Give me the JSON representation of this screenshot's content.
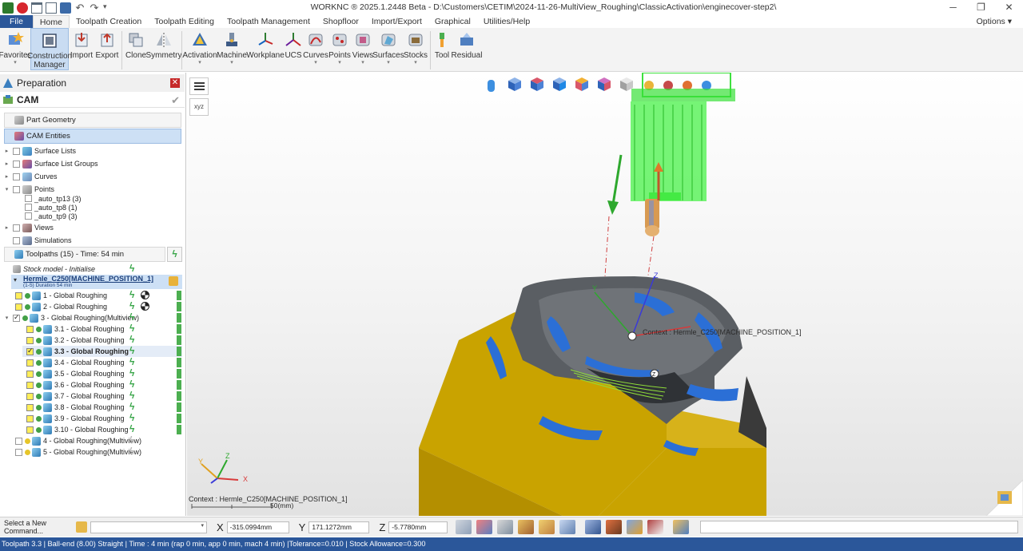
{
  "window": {
    "title": "WORKNC ® 2025.1.2448 Beta - D:\\Customers\\CETIM\\2024-11-26-MultiView_Roughing\\ClassicActivation\\enginecover-step2\\"
  },
  "menu": {
    "tabs": [
      "File",
      "Home",
      "Toolpath Creation",
      "Toolpath Editing",
      "Toolpath Management",
      "Shopfloor",
      "Import/Export",
      "Graphical",
      "Utilities/Help"
    ],
    "options": "Options"
  },
  "ribbon": {
    "favorites": "Favorites",
    "construction1": "Construction",
    "construction2": "Manager",
    "import": "Import",
    "export": "Export",
    "clone": "Clone",
    "symmetry": "Symmetry",
    "activation": "Activation",
    "machine": "Machine",
    "workplane": "Workplane",
    "ucs": "UCS",
    "curves": "Curves",
    "points": "Points",
    "views": "Views",
    "surfaces": "Surfaces",
    "stocks": "Stocks",
    "tool": "Tool",
    "residual": "Residual"
  },
  "panel": {
    "preparation": "Preparation",
    "cam": "CAM",
    "part_geometry": "Part Geometry",
    "cam_entities": "CAM Entities",
    "surface_lists": "Surface Lists",
    "surface_list_groups": "Surface List Groups",
    "curves": "Curves",
    "points": "Points",
    "pt1": "_auto_tp13 (3)",
    "pt2": "_auto_tp8 (1)",
    "pt3": "_auto_tp9 (3)",
    "views": "Views",
    "simulations": "Simulations",
    "toolpaths": "Toolpaths (15) - Time: 54 min",
    "stock_model": "Stock model - Initialise",
    "machine": "Hermle_C250[MACHINE_POSITION_1]",
    "machine_sub": "(1-5) Duration 54 min",
    "tp": [
      "1 - Global Roughing",
      "2 - Global Roughing",
      "3 - Global Roughing(Multiview)",
      "3.1 - Global Roughing",
      "3.2 - Global Roughing",
      "3.3 - Global Roughing",
      "3.4 - Global Roughing",
      "3.5 - Global Roughing",
      "3.6 - Global Roughing",
      "3.7 - Global Roughing",
      "3.8 - Global Roughing",
      "3.9 - Global Roughing",
      "3.10 - Global Roughing",
      "4 - Global Roughing(Multiview)",
      "5 - Global Roughing(Multiview)"
    ]
  },
  "viewport": {
    "context_label": "Context : Hermle_C250[MACHINE_POSITION_1]",
    "context_bottom": "Context : Hermle_C250[MACHINE_POSITION_1]",
    "scale": "50(mm)",
    "axis_x": "X",
    "axis_y": "Y",
    "axis_z": "Z",
    "marker_z": "Z",
    "marker_y": "Y",
    "axis_btn": "xyz"
  },
  "command": {
    "label": "Select a New Command...",
    "x_label": "X",
    "x_value": "-315.0994mm",
    "y_label": "Y",
    "y_value": "171.1272mm",
    "z_label": "Z",
    "z_value": "-5.7780mm"
  },
  "status": {
    "text": "Toolpath 3.3 | Ball-end (8.00) Straight | Time : 4 min (rap 0 min, app 0 min, mach 4 min) |Tolerance=0.010 | Stock Allowance=0.300"
  }
}
